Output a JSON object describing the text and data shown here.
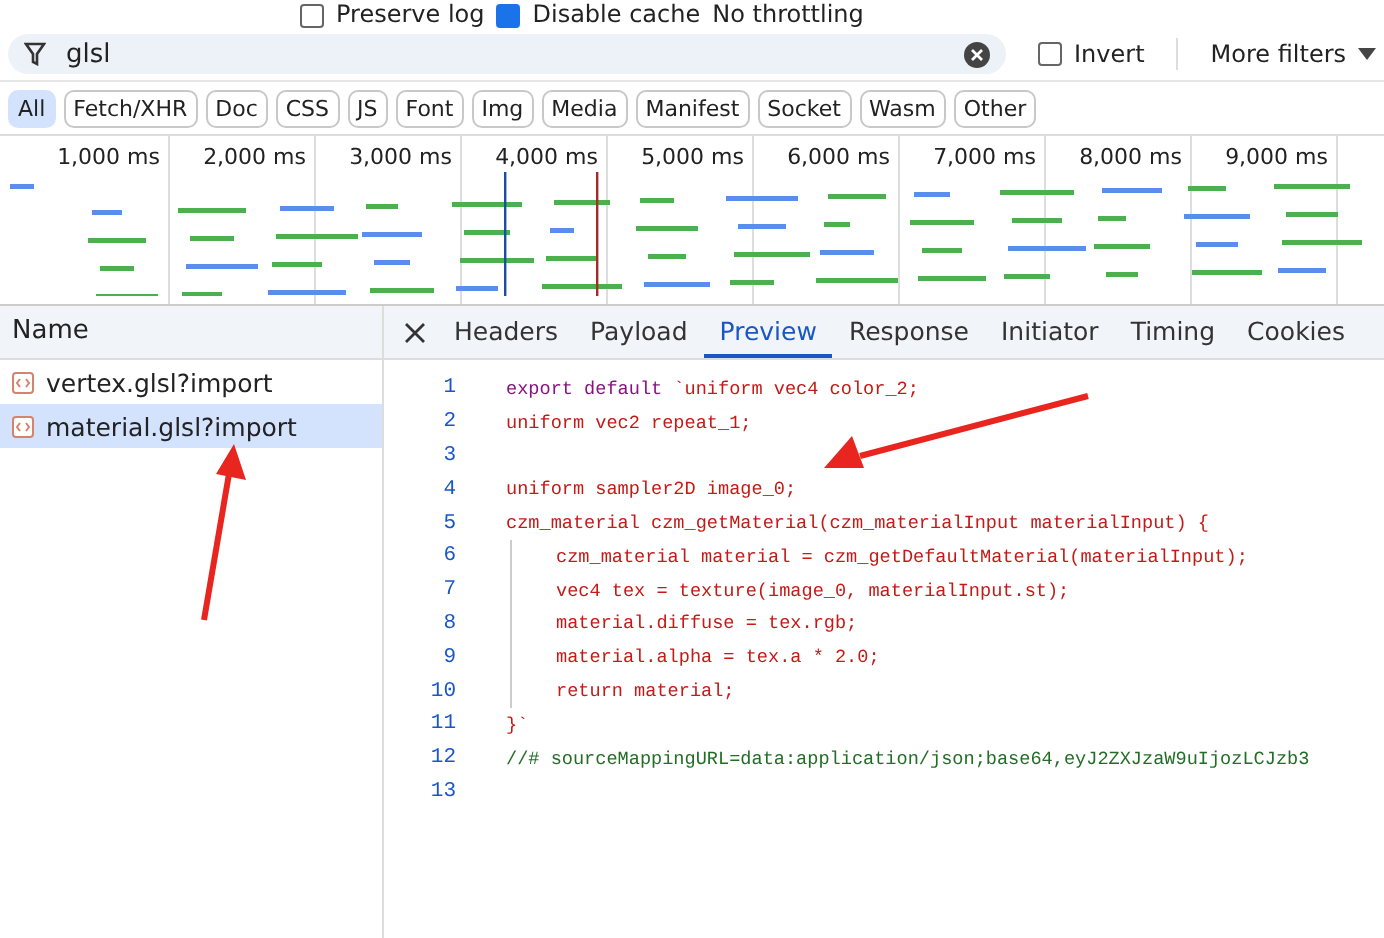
{
  "toolbar": {
    "preserve_log": {
      "label": "Preserve log",
      "checked": false
    },
    "disable_cache": {
      "label": "Disable cache",
      "checked": true
    },
    "throttling": "No throttling"
  },
  "filter": {
    "value": "glsl",
    "invert": {
      "label": "Invert",
      "checked": false
    },
    "more_filters": "More filters"
  },
  "type_filters": [
    {
      "label": "All",
      "selected": true
    },
    {
      "label": "Fetch/XHR",
      "selected": false
    },
    {
      "label": "Doc",
      "selected": false
    },
    {
      "label": "CSS",
      "selected": false
    },
    {
      "label": "JS",
      "selected": false
    },
    {
      "label": "Font",
      "selected": false
    },
    {
      "label": "Img",
      "selected": false
    },
    {
      "label": "Media",
      "selected": false
    },
    {
      "label": "Manifest",
      "selected": false
    },
    {
      "label": "Socket",
      "selected": false
    },
    {
      "label": "Wasm",
      "selected": false
    },
    {
      "label": "Other",
      "selected": false
    }
  ],
  "timeline": {
    "ticks": [
      "1,000 ms",
      "2,000 ms",
      "3,000 ms",
      "4,000 ms",
      "5,000 ms",
      "6,000 ms",
      "7,000 ms",
      "8,000 ms",
      "9,000 ms"
    ]
  },
  "requests": {
    "column": "Name",
    "rows": [
      {
        "name": "vertex.glsl?import",
        "selected": false
      },
      {
        "name": "material.glsl?import",
        "selected": true
      }
    ]
  },
  "tabs": [
    {
      "label": "Headers",
      "selected": false
    },
    {
      "label": "Payload",
      "selected": false
    },
    {
      "label": "Preview",
      "selected": true
    },
    {
      "label": "Response",
      "selected": false
    },
    {
      "label": "Initiator",
      "selected": false
    },
    {
      "label": "Timing",
      "selected": false
    },
    {
      "label": "Cookies",
      "selected": false
    }
  ],
  "code": [
    {
      "number": "1",
      "indent": false,
      "segments": [
        {
          "kind": "keyword",
          "text": "export default "
        },
        {
          "kind": "string",
          "text": "`uniform vec4 color_2;"
        }
      ]
    },
    {
      "number": "2",
      "indent": false,
      "segments": [
        {
          "kind": "string",
          "text": "uniform vec2 repeat_1;"
        }
      ]
    },
    {
      "number": "3",
      "indent": false
    },
    {
      "number": "4",
      "indent": false,
      "segments": [
        {
          "kind": "string",
          "text": "uniform sampler2D image_0;"
        }
      ]
    },
    {
      "number": "5",
      "indent": false,
      "segments": [
        {
          "kind": "string",
          "text": "czm_material czm_getMaterial(czm_materialInput materialInput) {"
        }
      ]
    },
    {
      "number": "6",
      "indent": true,
      "segments": [
        {
          "kind": "string",
          "text": "czm_material material = czm_getDefaultMaterial(materialInput);"
        }
      ]
    },
    {
      "number": "7",
      "indent": true,
      "segments": [
        {
          "kind": "string",
          "text": "vec4 tex = texture(image_0, materialInput.st);"
        }
      ]
    },
    {
      "number": "8",
      "indent": true,
      "segments": [
        {
          "kind": "string",
          "text": "material.diffuse = tex.rgb;"
        }
      ]
    },
    {
      "number": "9",
      "indent": true,
      "segments": [
        {
          "kind": "string",
          "text": "material.alpha = tex.a * 2.0;"
        }
      ]
    },
    {
      "number": "10",
      "indent": true,
      "segments": [
        {
          "kind": "string",
          "text": "return material;"
        }
      ]
    },
    {
      "number": "11",
      "indent": false,
      "segments": [
        {
          "kind": "string",
          "text": "}`"
        }
      ]
    },
    {
      "number": "12",
      "indent": false,
      "segments": [
        {
          "kind": "comment",
          "text": "//# sourceMappingURL=data:application/json;base64,eyJ2ZXJzaW9uIjozLCJzb3"
        }
      ]
    },
    {
      "number": "13",
      "indent": false
    }
  ]
}
